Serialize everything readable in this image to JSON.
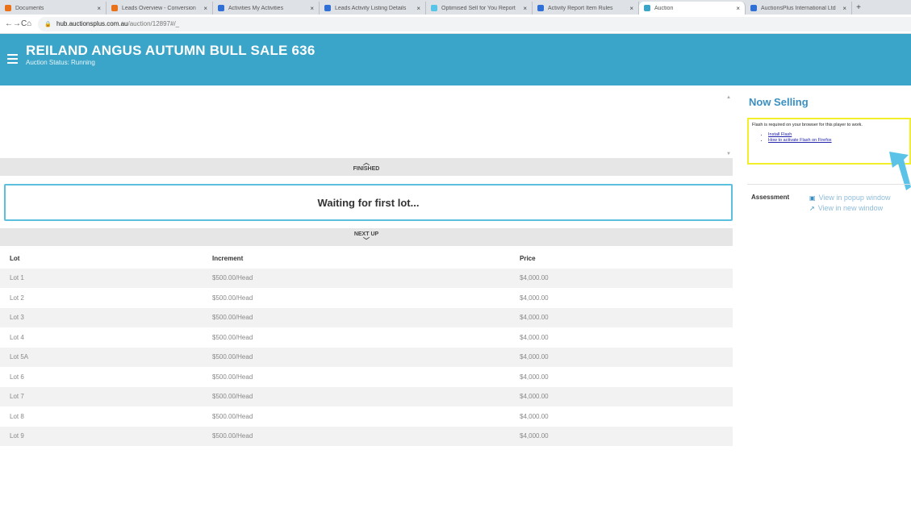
{
  "browser": {
    "tabs": [
      {
        "title": "Documents",
        "color": "#e8711a"
      },
      {
        "title": "Leads Overview - Conversion",
        "color": "#e8711a"
      },
      {
        "title": "Activities My Activities",
        "color": "#2f6fd6"
      },
      {
        "title": "Leads Activity Listing Details",
        "color": "#2f6fd6"
      },
      {
        "title": "Optimised Sell for You Report",
        "color": "#57c4e8"
      },
      {
        "title": "Activity Report Item Rules",
        "color": "#2f6fd6"
      },
      {
        "title": "Auction",
        "color": "#3aa5c8",
        "active": true
      },
      {
        "title": "AuctionsPlus International Ltd",
        "color": "#2f6fd6"
      }
    ],
    "url_host": "hub.auctionsplus.com.au",
    "url_path": "/auction/12897#/_"
  },
  "header": {
    "title": "REILAND ANGUS AUTUMN BULL SALE 636",
    "status": "Auction Status: Running"
  },
  "main": {
    "finished_label": "FINISHED",
    "waiting_text": "Waiting for first lot...",
    "next_up_label": "NEXT UP"
  },
  "lots_table": {
    "columns": [
      "Lot",
      "Increment",
      "Price"
    ],
    "rows": [
      [
        "Lot 1",
        "$500.00/Head",
        "$4,000.00"
      ],
      [
        "Lot 2",
        "$500.00/Head",
        "$4,000.00"
      ],
      [
        "Lot 3",
        "$500.00/Head",
        "$4,000.00"
      ],
      [
        "Lot 4",
        "$500.00/Head",
        "$4,000.00"
      ],
      [
        "Lot 5A",
        "$500.00/Head",
        "$4,000.00"
      ],
      [
        "Lot 6",
        "$500.00/Head",
        "$4,000.00"
      ],
      [
        "Lot 7",
        "$500.00/Head",
        "$4,000.00"
      ],
      [
        "Lot 8",
        "$500.00/Head",
        "$4,000.00"
      ],
      [
        "Lot 9",
        "$500.00/Head",
        "$4,000.00"
      ]
    ]
  },
  "sidebar": {
    "now_selling": "Now Selling",
    "flash_message": "Flash is required on your browser for this player to work.",
    "flash_links": [
      "Install Flash",
      "How to activate Flash on Firefox"
    ],
    "assessment_label": "Assessment",
    "view_popup": "View in popup window",
    "view_new": "View in new window"
  },
  "colors": {
    "header_bg": "#3aa5c8",
    "now_selling": "#3a8fc0",
    "waiting_border": "#5bc0de",
    "flash_border": "#f2ef2a"
  }
}
